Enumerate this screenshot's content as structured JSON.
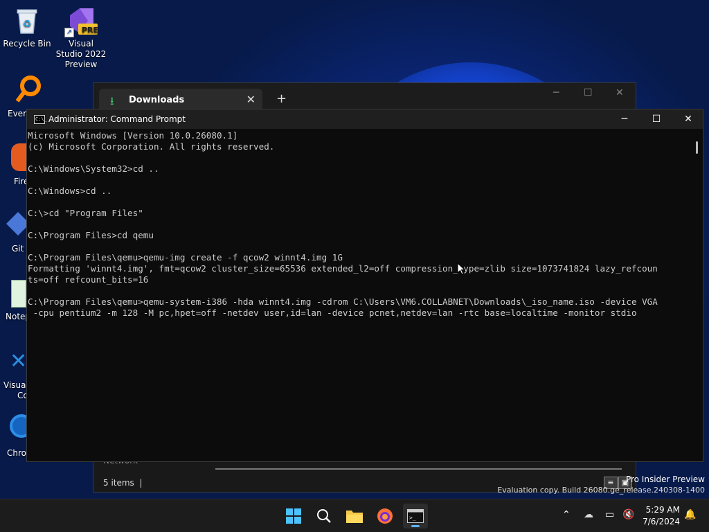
{
  "desktop": {
    "icons": [
      {
        "label": "Recycle Bin"
      },
      {
        "label": "Visual Studio 2022 Preview",
        "badge": "PRE"
      }
    ],
    "partial_labels": [
      "Every",
      "Fire",
      "Git B",
      "Notep",
      "Visual",
      "Co",
      "Chron"
    ]
  },
  "explorer": {
    "tab_title": "Downloads",
    "new_tab_symbol": "+",
    "close_symbol": "✕",
    "nav_item": "Network",
    "status_items": "5 items",
    "status_sep": "|"
  },
  "cmd": {
    "title": "Administrator: Command Prompt",
    "icon_text": "C:\\_",
    "lines": [
      "Microsoft Windows [Version 10.0.26080.1]",
      "(c) Microsoft Corporation. All rights reserved.",
      "",
      "C:\\Windows\\System32>cd ..",
      "",
      "C:\\Windows>cd ..",
      "",
      "C:\\>cd \"Program Files\"",
      "",
      "C:\\Program Files>cd qemu",
      "",
      "C:\\Program Files\\qemu>qemu-img create -f qcow2 winnt4.img 1G",
      "Formatting 'winnt4.img', fmt=qcow2 cluster_size=65536 extended_l2=off compression_type=zlib size=1073741824 lazy_refcoun",
      "ts=off refcount_bits=16",
      "",
      "C:\\Program Files\\qemu>qemu-system-i386 -hda winnt4.img -cdrom C:\\Users\\VM6.COLLABNET\\Downloads\\_iso_name.iso -device VGA",
      " -cpu pentium2 -m 128 -M pc,hpet=off -netdev user,id=lan -device pcnet,netdev=lan -rtc base=localtime -monitor stdio"
    ]
  },
  "taskbar": {
    "apps": [
      "start-icon",
      "search-icon",
      "file-explorer-icon",
      "firefox-icon",
      "terminal-icon"
    ],
    "clock_time": "5:29 AM",
    "clock_date": "7/6/2024"
  },
  "watermark": {
    "line1": "Pro Insider Preview",
    "line2": "Evaluation copy. Build 26080.ge_release.240308-1400"
  },
  "colors": {
    "console_bg": "#0c0c0c",
    "console_fg": "#cccccc",
    "taskbar_bg": "#1c1c1c",
    "accent": "#5fb2f2"
  }
}
